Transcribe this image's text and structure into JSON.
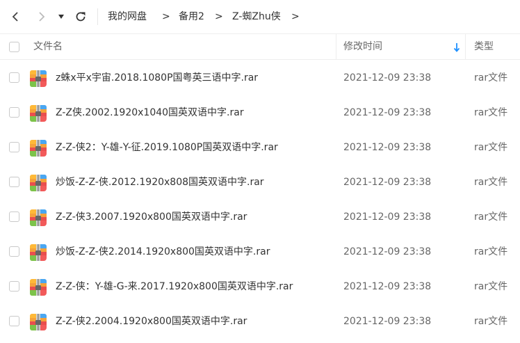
{
  "breadcrumb": [
    "我的网盘",
    "备用2",
    "Z-蜘Zhu侠"
  ],
  "breadcrumb_separator": ">",
  "columns": {
    "name": "文件名",
    "modified": "修改时间",
    "type": "类型"
  },
  "colors": {
    "sort_arrow": "#1e90ff",
    "border": "#eeeeee"
  },
  "icons": {
    "back": "chevron-left-icon",
    "forward": "chevron-right-icon",
    "dropdown": "caret-down-icon",
    "refresh": "refresh-icon",
    "sort": "sort-down-arrow-icon",
    "file": "rar-archive-icon"
  },
  "files": [
    {
      "name": "z蛛x平x宇宙.2018.1080P国粤英三语中字.rar",
      "modified": "2021-12-09 23:38",
      "type": "rar文件"
    },
    {
      "name": "Z-Z侠.2002.1920x1040国英双语中字.rar",
      "modified": "2021-12-09 23:38",
      "type": "rar文件"
    },
    {
      "name": "Z-Z-侠2：Y-雄-Y-征.2019.1080P国英双语中字.rar",
      "modified": "2021-12-09 23:38",
      "type": "rar文件"
    },
    {
      "name": "炒饭-Z-Z-侠.2012.1920x808国英双语中字.rar",
      "modified": "2021-12-09 23:38",
      "type": "rar文件"
    },
    {
      "name": "Z-Z-侠3.2007.1920x800国英双语中字.rar",
      "modified": "2021-12-09 23:38",
      "type": "rar文件"
    },
    {
      "name": "炒饭-Z-Z-侠2.2014.1920x800国英双语中字.rar",
      "modified": "2021-12-09 23:38",
      "type": "rar文件"
    },
    {
      "name": "Z-Z-侠：Y-雄-G-来.2017.1920x800国英双语中字.rar",
      "modified": "2021-12-09 23:38",
      "type": "rar文件"
    },
    {
      "name": "Z-Z-侠2.2004.1920x800国英双语中字.rar",
      "modified": "2021-12-09 23:38",
      "type": "rar文件"
    }
  ]
}
